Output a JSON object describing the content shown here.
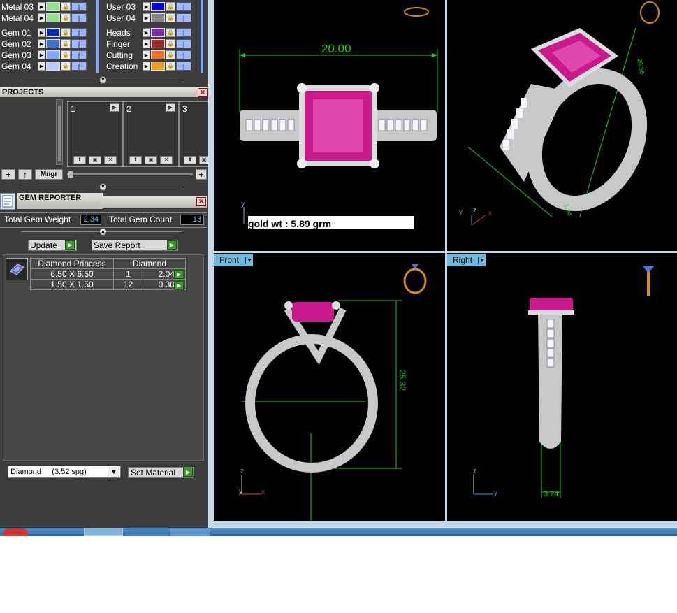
{
  "layers": {
    "left": [
      {
        "label": "Metal 03",
        "color": "#8fe08f"
      },
      {
        "label": "Metal 04",
        "color": "#8fe08f"
      },
      {
        "label": "Gem 01",
        "color": "#0a2ea8"
      },
      {
        "label": "Gem 02",
        "color": "#3d6fd6"
      },
      {
        "label": "Gem 03",
        "color": "#7fa9ff"
      },
      {
        "label": "Gem 04",
        "color": "#b4ccff"
      }
    ],
    "right": [
      {
        "label": "User 03",
        "color": "#0000e0"
      },
      {
        "label": "User 04",
        "color": "#888888"
      },
      {
        "label": "Heads",
        "color": "#7b2aa8"
      },
      {
        "label": "Finger",
        "color": "#a02828"
      },
      {
        "label": "Cutting",
        "color": "#f07020"
      },
      {
        "label": "Creation",
        "color": "#f0a020"
      }
    ]
  },
  "projects": {
    "title": "PROJECTS",
    "slots": [
      "1",
      "2",
      "3"
    ],
    "mngr_label": "Mngr",
    "add_label": "+",
    "up_label": "↑",
    "plus_label": "+"
  },
  "gem_reporter": {
    "title": "GEM REPORTER",
    "total_weight_label": "Total Gem Weight",
    "total_weight_value": "2.34",
    "total_count_label": "Total Gem Count",
    "total_count_value": "13",
    "update_label": "Update",
    "save_report_label": "Save Report",
    "table_header_shape": "Diamond Princess",
    "table_header_material": "Diamond",
    "rows": [
      {
        "size": "6.50 X 6.50",
        "count": "1",
        "weight": "2.04tw"
      },
      {
        "size": "1.50 X 1.50",
        "count": "12",
        "weight": "0.30tw"
      }
    ],
    "material_select": "Diamond     (3.52 spg)",
    "set_material_label": "Set Material"
  },
  "viewports": {
    "top_dimension": "20.00",
    "gold_wt": "gold wt : 5.89 grm",
    "front_label": "Front",
    "right_label": "Right",
    "front_height": "25.32",
    "right_width": "3.24",
    "persp_dim1": "26.36",
    "persp_dim2": "1.34",
    "axis_x": "x",
    "axis_y": "y",
    "axis_z": "z"
  },
  "colors": {
    "gem": "#c81a8c",
    "metal": "#c8c8c8",
    "dimension": "#19d219",
    "panel_bg": "#3c3c3c",
    "viewport_label": "#6fb9dd"
  }
}
